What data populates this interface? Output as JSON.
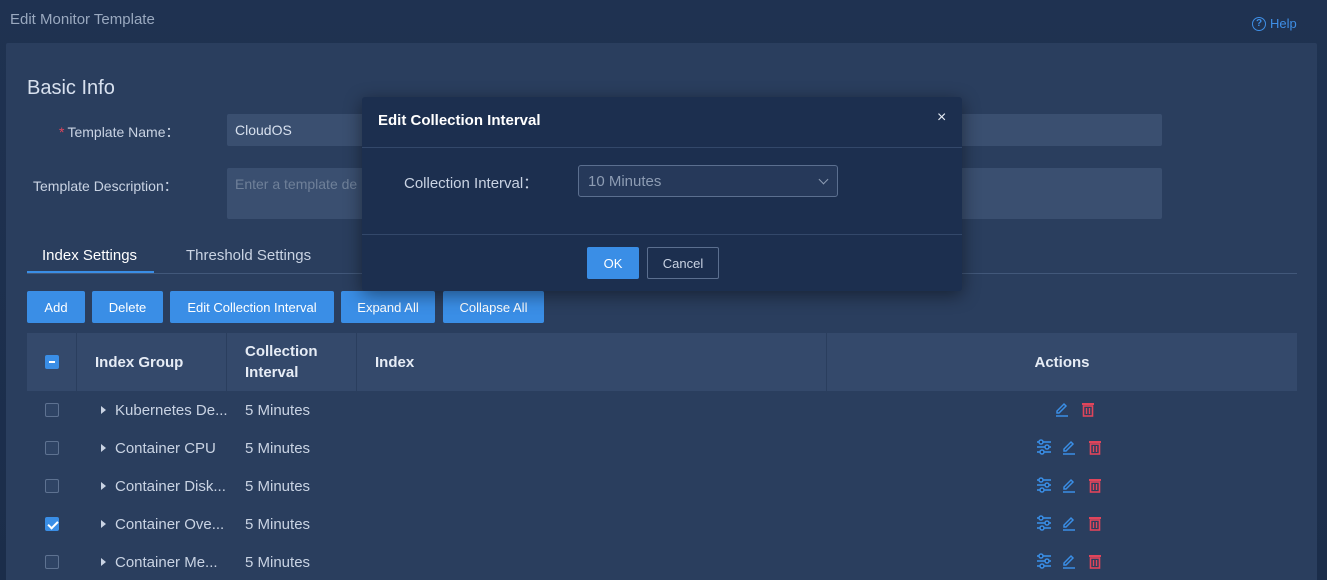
{
  "header": {
    "title": "Edit Monitor Template",
    "help_label": "Help"
  },
  "basic_info": {
    "section_title": "Basic Info",
    "required_mark": "*",
    "template_name_label": "Template Name：",
    "template_name_value": "CloudOS",
    "template_description_label": "Template Description：",
    "template_description_placeholder": "Enter a template de"
  },
  "tabs": [
    {
      "label": "Index Settings",
      "active": true
    },
    {
      "label": "Threshold Settings",
      "active": false
    }
  ],
  "toolbar": {
    "add": "Add",
    "delete": "Delete",
    "edit_interval": "Edit Collection Interval",
    "expand_all": "Expand All",
    "collapse_all": "Collapse All"
  },
  "table": {
    "columns": [
      "Index Group",
      "Collection Interval",
      "Index",
      "Actions"
    ],
    "rows": [
      {
        "group": "Kubernetes De...",
        "interval": "5 Minutes",
        "checked": false,
        "has_settings": false
      },
      {
        "group": "Container CPU",
        "interval": "5 Minutes",
        "checked": false,
        "has_settings": true
      },
      {
        "group": "Container Disk...",
        "interval": "5 Minutes",
        "checked": false,
        "has_settings": true
      },
      {
        "group": "Container Ove...",
        "interval": "5 Minutes",
        "checked": true,
        "has_settings": true
      },
      {
        "group": "Container Me...",
        "interval": "5 Minutes",
        "checked": false,
        "has_settings": true
      }
    ]
  },
  "modal": {
    "title": "Edit Collection Interval",
    "close": "×",
    "field_label": "Collection Interval：",
    "selected_value": "10 Minutes",
    "ok": "OK",
    "cancel": "Cancel"
  },
  "colors": {
    "accent": "#3a8ee6",
    "danger": "#e0455b",
    "panel": "#2a3e5e"
  }
}
